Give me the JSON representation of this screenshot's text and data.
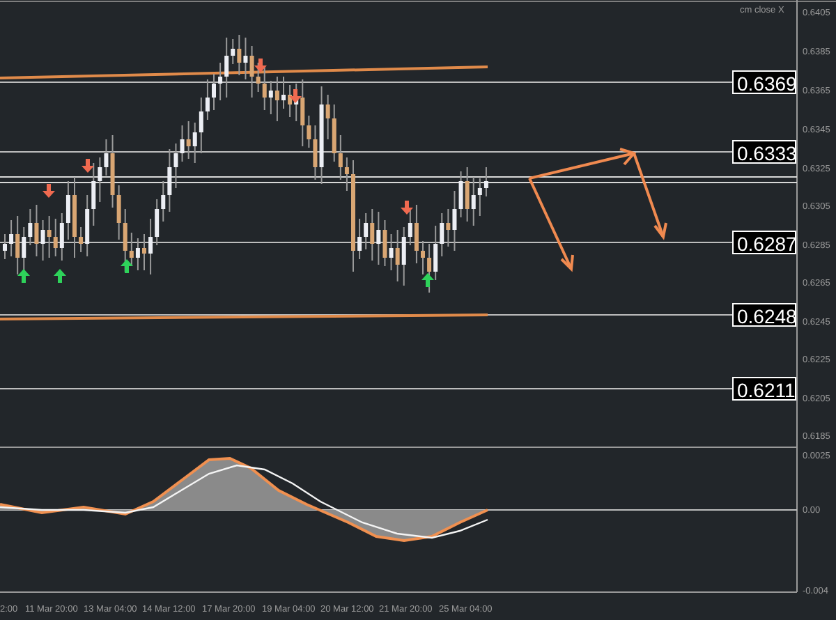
{
  "chart": {
    "indicator_label": "cm close X",
    "price_axis": [
      "0.6405",
      "0.6385",
      "0.6365",
      "0.6345",
      "0.6325",
      "0.6305",
      "0.6285",
      "0.6265",
      "0.6245",
      "0.6225",
      "0.6205",
      "0.6185"
    ],
    "price_lines": [
      {
        "label": "0.6369"
      },
      {
        "label": "0.6333"
      },
      {
        "label": "0.6287"
      },
      {
        "label": "0.6248"
      },
      {
        "label": "0.6211"
      }
    ],
    "indicator_axis": [
      "0.0025",
      "0.00",
      "-0.004"
    ],
    "time_axis": [
      "2:00",
      "11 Mar 20:00",
      "13 Mar 04:00",
      "14 Mar 12:00",
      "17 Mar 20:00",
      "19 Mar 04:00",
      "20 Mar 12:00",
      "21 Mar 20:00",
      "25 Mar 04:00"
    ]
  }
}
